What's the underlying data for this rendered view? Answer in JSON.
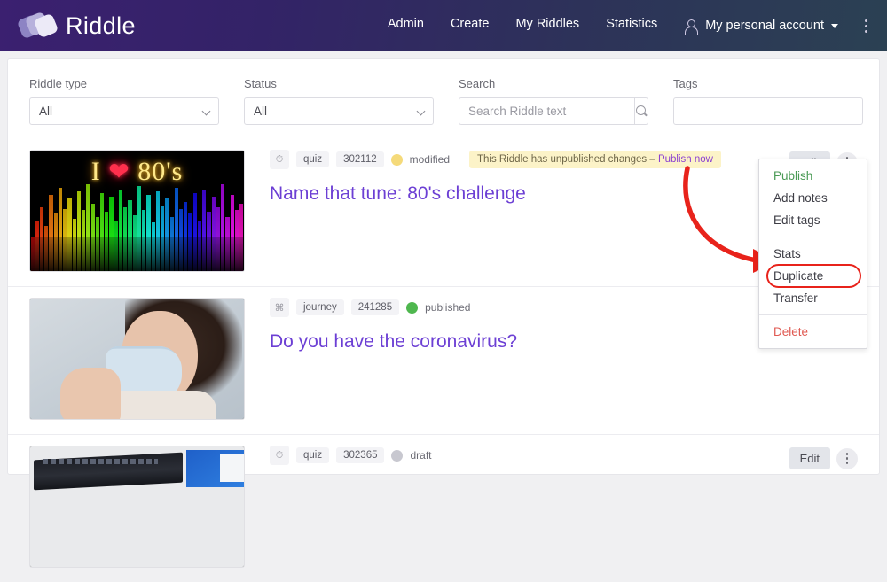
{
  "header": {
    "brand": "Riddle",
    "logo_icon": "riddle-stacked-cards-logo",
    "nav": [
      {
        "label": "Admin",
        "active": false
      },
      {
        "label": "Create",
        "active": false
      },
      {
        "label": "My Riddles",
        "active": true
      },
      {
        "label": "Statistics",
        "active": false
      }
    ],
    "account": {
      "icon": "person-icon",
      "label": "My personal account",
      "caret": "chevron-down-icon"
    },
    "overflow_icon": "vertical-kebab-icon",
    "background_start": "#3b2070",
    "background_end": "#2b4153"
  },
  "filters": {
    "riddle_type": {
      "label": "Riddle type",
      "value": "All"
    },
    "status": {
      "label": "Status",
      "value": "All"
    },
    "search": {
      "label": "Search",
      "value": "",
      "placeholder": "Search Riddle text",
      "button_icon": "search-icon"
    },
    "tags": {
      "label": "Tags",
      "value": "",
      "placeholder": ""
    }
  },
  "riddles": [
    {
      "type_icon": "quiz-clock-icon",
      "type": "quiz",
      "id": "302112",
      "state": "modified",
      "state_color": "#f5da7a",
      "banner_text": "This Riddle has unpublished changes – ",
      "banner_link": "Publish now",
      "title": "Name that tune: 80's challenge",
      "thumb_alt": "neon-80s-equalizer-image",
      "edit_label": "Edit",
      "menu_icon": "vertical-kebab-icon"
    },
    {
      "type_icon": "journey-icon",
      "type": "journey",
      "id": "241285",
      "state": "published",
      "state_color": "#4fb74f",
      "banner_text": "",
      "banner_link": "",
      "title": "Do you have the coronavirus?",
      "thumb_alt": "woman-wearing-face-mask-image",
      "edit_label": "",
      "menu_icon": ""
    },
    {
      "type_icon": "quiz-clock-icon",
      "type": "quiz",
      "id": "302365",
      "state": "draft",
      "state_color": "#c8c8d0",
      "banner_text": "",
      "banner_link": "",
      "title": "",
      "thumb_alt": "laptop-on-desk-image",
      "edit_label": "Edit",
      "menu_icon": "vertical-kebab-icon"
    }
  ],
  "dropdown": {
    "items": [
      {
        "label": "Publish",
        "style": "green"
      },
      {
        "label": "Add notes",
        "style": "normal"
      },
      {
        "label": "Edit tags",
        "style": "normal"
      },
      {
        "label": "Stats",
        "style": "normal"
      },
      {
        "label": "Duplicate",
        "style": "normal",
        "highlighted": true
      },
      {
        "label": "Transfer",
        "style": "normal"
      },
      {
        "label": "Delete",
        "style": "red"
      }
    ],
    "highlight_color": "#e8231b"
  },
  "annotation": {
    "arrow_color": "#e8231b",
    "points_to": "Duplicate"
  }
}
